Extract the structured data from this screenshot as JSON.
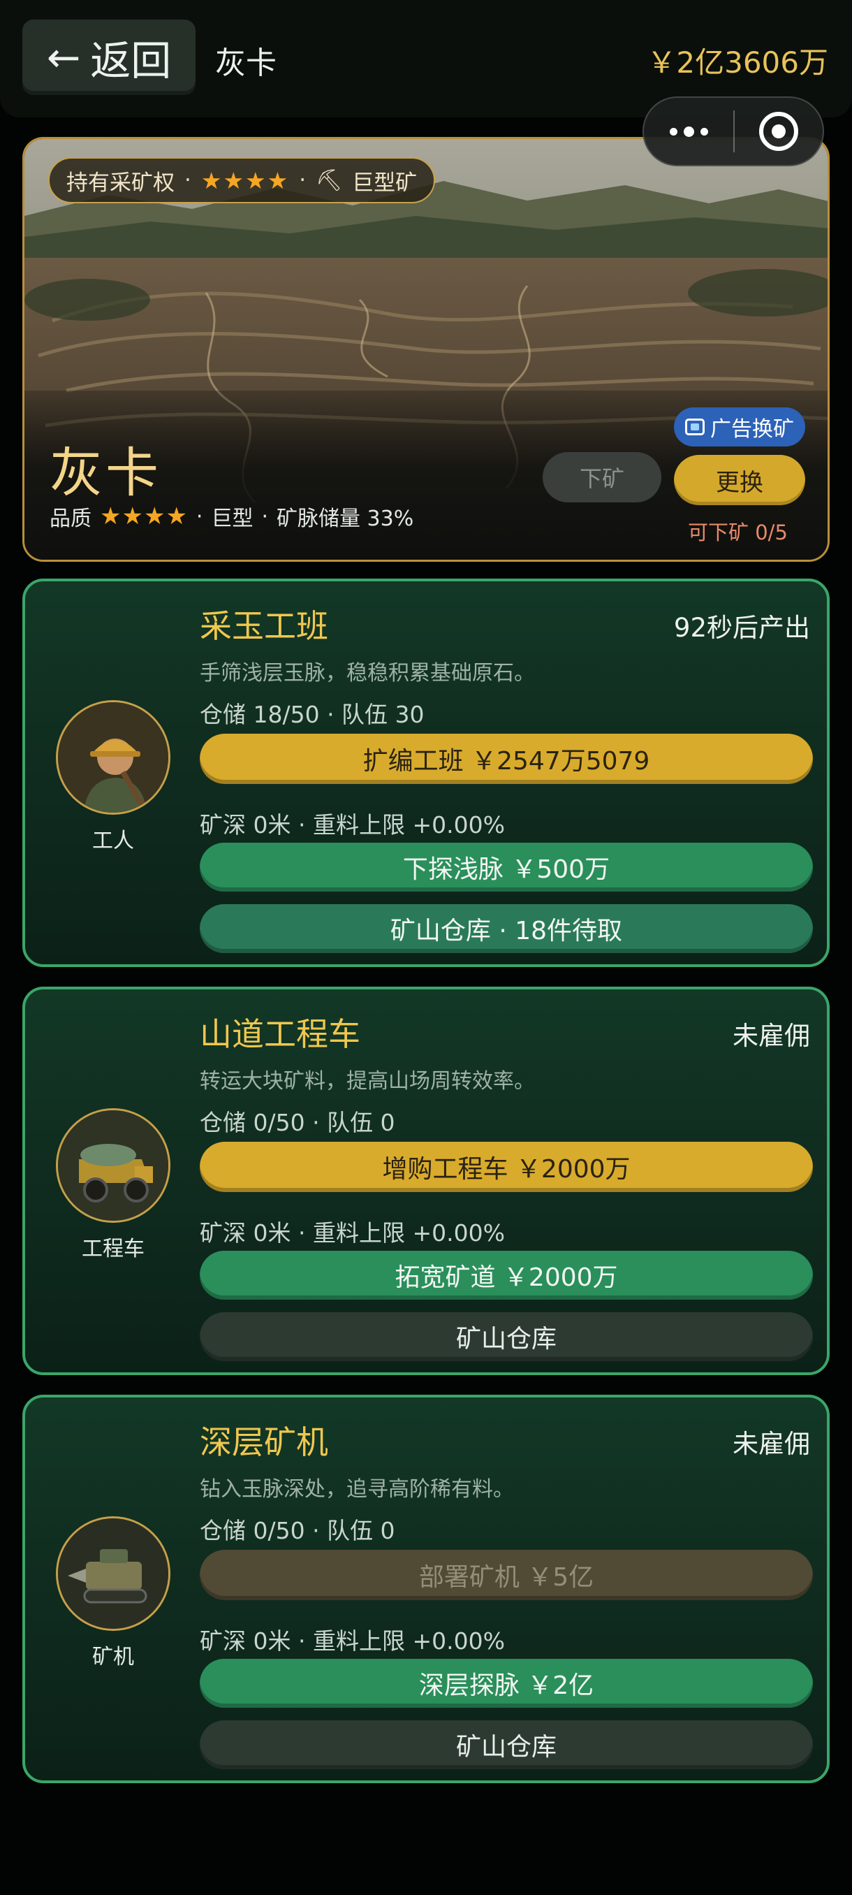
{
  "header": {
    "back_arrow": "←",
    "back_label": "返回",
    "title": "灰卡",
    "balance": "￥2亿3606万"
  },
  "hero": {
    "tag_rights": "持有采矿权",
    "tag_stars": "★★★★",
    "tag_size": "巨型矿",
    "name": "灰卡",
    "quality_label": "品质",
    "quality_stars": "★★★★",
    "size": "巨型",
    "reserve": "矿脉储量 33%",
    "ad_label": "广告换矿",
    "down_label": "下矿",
    "swap_label": "更换",
    "can_down": "可下矿 0/5"
  },
  "cards": [
    {
      "title": "采玉工班",
      "status": "92秒后产出",
      "desc": "手筛浅层玉脉，稳稳积累基础原石。",
      "stock": "仓储 18/50 · 队伍 30",
      "upgrade": "扩编工班 ￥2547万5079",
      "depth": "矿深 0米 · 重料上限 +0.00%",
      "explore": "下探浅脉 ￥500万",
      "storage": "矿山仓库 · 18件待取",
      "avatar_label": "工人"
    },
    {
      "title": "山道工程车",
      "status": "未雇佣",
      "desc": "转运大块矿料，提高山场周转效率。",
      "stock": "仓储 0/50 · 队伍 0",
      "upgrade": "增购工程车 ￥2000万",
      "depth": "矿深 0米 · 重料上限 +0.00%",
      "explore": "拓宽矿道 ￥2000万",
      "storage": "矿山仓库",
      "avatar_label": "工程车"
    },
    {
      "title": "深层矿机",
      "status": "未雇佣",
      "desc": "钻入玉脉深处，追寻高阶稀有料。",
      "stock": "仓储 0/50 · 队伍 0",
      "upgrade": "部署矿机 ￥5亿",
      "depth": "矿深 0米 · 重料上限 +0.00%",
      "explore": "深层探脉 ￥2亿",
      "storage": "矿山仓库",
      "avatar_label": "矿机"
    }
  ],
  "colors": {
    "accent_gold": "#d9ab2c",
    "card_border": "#3aa669",
    "title_gold": "#f0c74f"
  }
}
